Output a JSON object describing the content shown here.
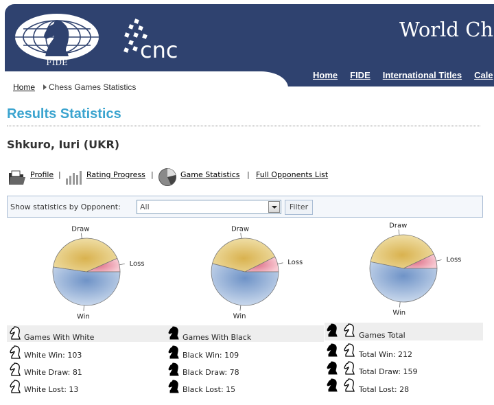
{
  "header": {
    "fide_logo_text": "FIDE",
    "title": "World Che",
    "nav": [
      "Home",
      "FIDE",
      "International Titles",
      "Cale"
    ]
  },
  "breadcrumb": {
    "home": "Home",
    "current": "Chess Games Statistics"
  },
  "page": {
    "title": "Results Statistics",
    "player_name": "Shkuro, Iuri (UKR)"
  },
  "subnav": {
    "profile": "Profile",
    "rating_progress": "Rating Progress",
    "game_statistics": "Game Statistics",
    "full_opponents_list": "Full Opponents List",
    "separator": "|"
  },
  "filter": {
    "label": "Show statistics by Opponent:",
    "selected": "All",
    "button": "Filter"
  },
  "chart_labels": {
    "draw": "Draw",
    "loss": "Loss",
    "win": "Win"
  },
  "colors": {
    "win": "#9fb8da",
    "draw": "#e7cf85",
    "loss": "#ef9fae",
    "title_blue": "#3ba4cf",
    "header_navy": "#2f426f"
  },
  "chart_data": [
    {
      "type": "pie",
      "categories": [
        "Win",
        "Draw",
        "Loss"
      ],
      "values": [
        103,
        81,
        13
      ]
    },
    {
      "type": "pie",
      "categories": [
        "Win",
        "Draw",
        "Loss"
      ],
      "values": [
        109,
        78,
        15
      ]
    },
    {
      "type": "pie",
      "categories": [
        "Win",
        "Draw",
        "Loss"
      ],
      "values": [
        212,
        159,
        28
      ]
    }
  ],
  "stats": {
    "white": {
      "heading": "Games With White",
      "win": "White Win: 103",
      "draw": "White Draw: 81",
      "lost": "White Lost: 13"
    },
    "black": {
      "heading": "Games With Black",
      "win": "Black Win: 109",
      "draw": "Black Draw: 78",
      "lost": "Black Lost: 15"
    },
    "total": {
      "heading": "Games Total",
      "win": "Total Win: 212",
      "draw": "Total Draw: 159",
      "lost": "Total Lost: 28"
    }
  }
}
